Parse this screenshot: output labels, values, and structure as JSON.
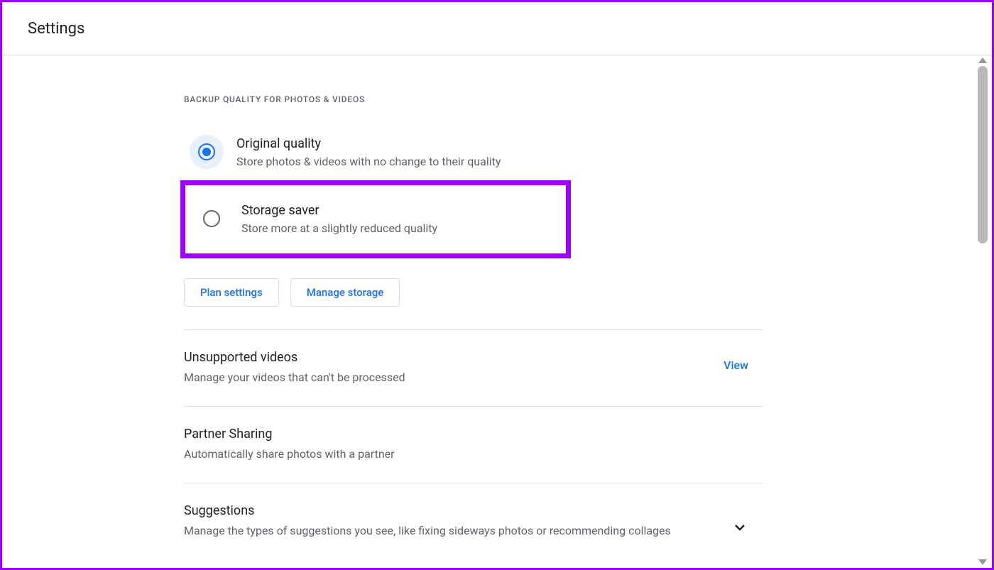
{
  "header": {
    "title": "Settings"
  },
  "backup_quality": {
    "section_label": "BACKUP QUALITY FOR PHOTOS & VIDEOS",
    "options": [
      {
        "title": "Original quality",
        "description": "Store photos & videos with no change to their quality",
        "selected": true
      },
      {
        "title": "Storage saver",
        "description": "Store more at a slightly reduced quality",
        "selected": false
      }
    ],
    "buttons": {
      "plan_settings": "Plan settings",
      "manage_storage": "Manage storage"
    }
  },
  "unsupported_videos": {
    "title": "Unsupported videos",
    "description": "Manage your videos that can't be processed",
    "action": "View"
  },
  "partner_sharing": {
    "title": "Partner Sharing",
    "description": "Automatically share photos with a partner"
  },
  "suggestions": {
    "title": "Suggestions",
    "description": "Manage the types of suggestions you see, like fixing sideways photos or recommending collages"
  }
}
